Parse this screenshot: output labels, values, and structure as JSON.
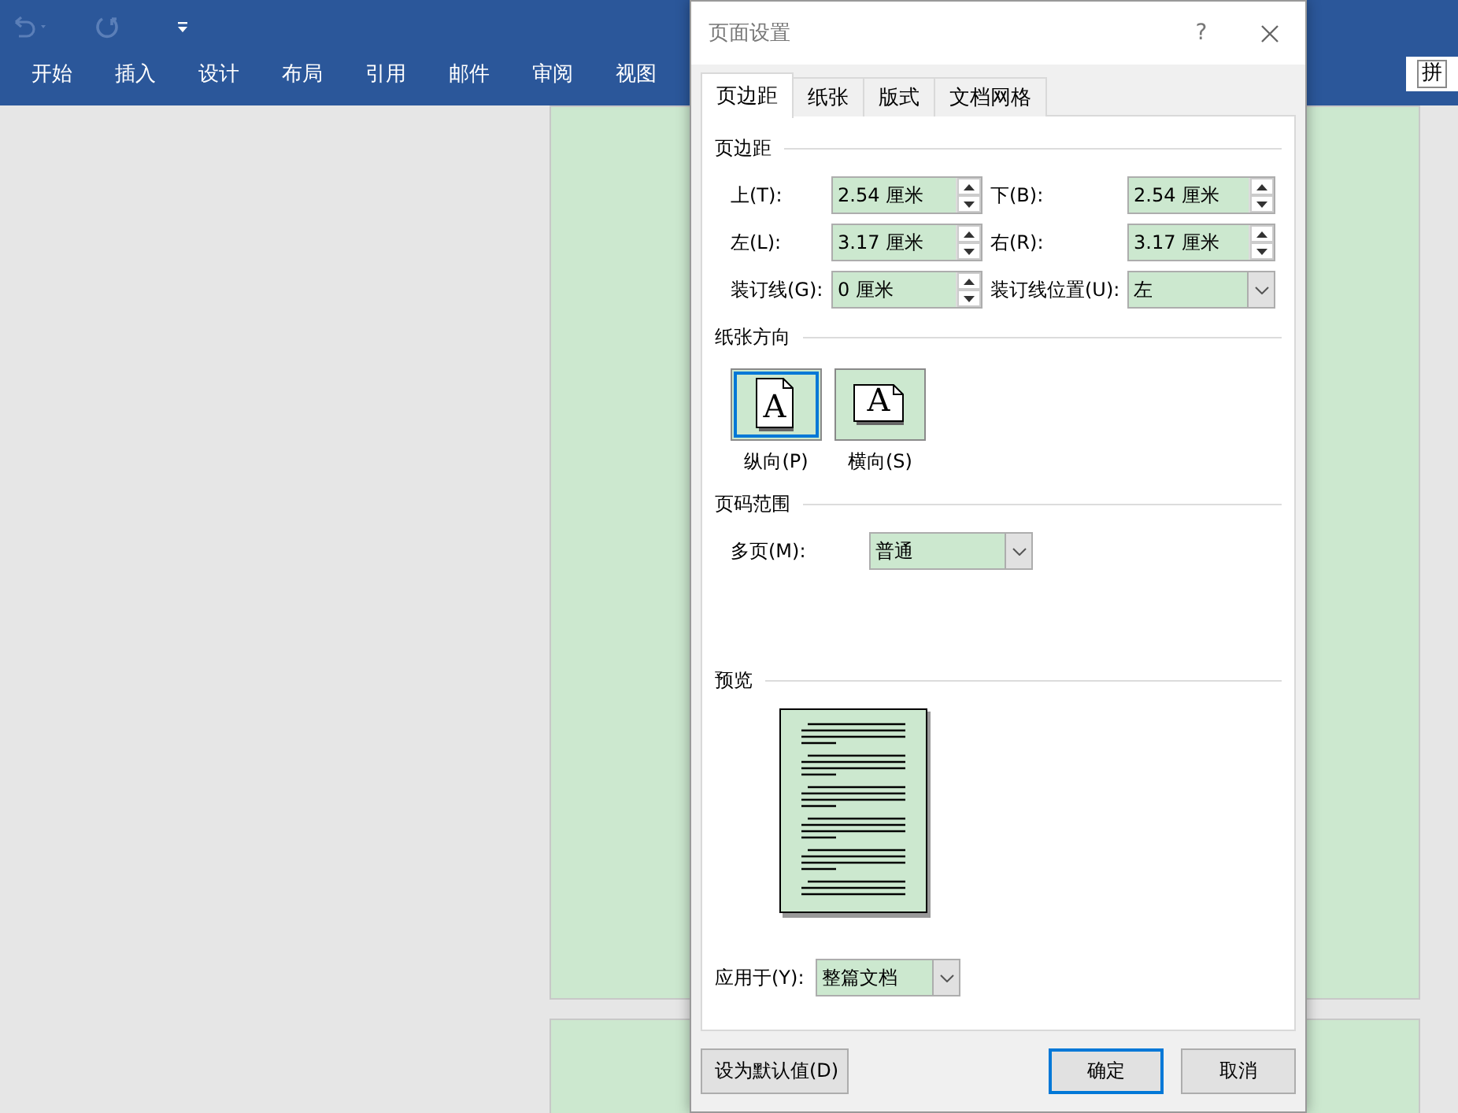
{
  "ribbon": {
    "tabs": [
      {
        "label": "开始",
        "selected": false
      },
      {
        "label": "插入",
        "selected": false
      },
      {
        "label": "设计",
        "selected": false
      },
      {
        "label": "布局",
        "selected": false
      },
      {
        "label": "引用",
        "selected": false
      },
      {
        "label": "邮件",
        "selected": false
      },
      {
        "label": "审阅",
        "selected": false
      },
      {
        "label": "视图",
        "selected": false
      }
    ]
  },
  "ime": {
    "label": "拼"
  },
  "dialog": {
    "title": "页面设置",
    "help": "?",
    "tabs": [
      {
        "label": "页边距",
        "selected": true
      },
      {
        "label": "纸张",
        "selected": false
      },
      {
        "label": "版式",
        "selected": false
      },
      {
        "label": "文档网格",
        "selected": false
      }
    ],
    "margins": {
      "heading": "页边距",
      "fields": [
        {
          "label": "上(T):",
          "value": "2.54 厘米",
          "kind": "spin"
        },
        {
          "label": "下(B):",
          "value": "2.54 厘米",
          "kind": "spin"
        },
        {
          "label": "左(L):",
          "value": "3.17 厘米",
          "kind": "spin"
        },
        {
          "label": "右(R):",
          "value": "3.17 厘米",
          "kind": "spin"
        },
        {
          "label": "装订线(G):",
          "value": "0 厘米",
          "kind": "spin"
        },
        {
          "label": "装订线位置(U):",
          "value": "左",
          "kind": "dropdown"
        }
      ]
    },
    "orientation": {
      "heading": "纸张方向",
      "options": [
        {
          "label": "纵向(P)",
          "glyph": "A",
          "kind": "portrait",
          "selected": true
        },
        {
          "label": "横向(S)",
          "glyph": "A",
          "kind": "landscape",
          "selected": false
        }
      ]
    },
    "pages": {
      "heading": "页码范围",
      "label": "多页(M):",
      "value": "普通"
    },
    "preview": {
      "heading": "预览"
    },
    "apply": {
      "label": "应用于(Y):",
      "value": "整篇文档"
    },
    "buttons": [
      {
        "label": "设为默认值(D)",
        "default": false
      },
      {
        "label": "确定",
        "default": true
      },
      {
        "label": "取消",
        "default": false
      }
    ]
  }
}
